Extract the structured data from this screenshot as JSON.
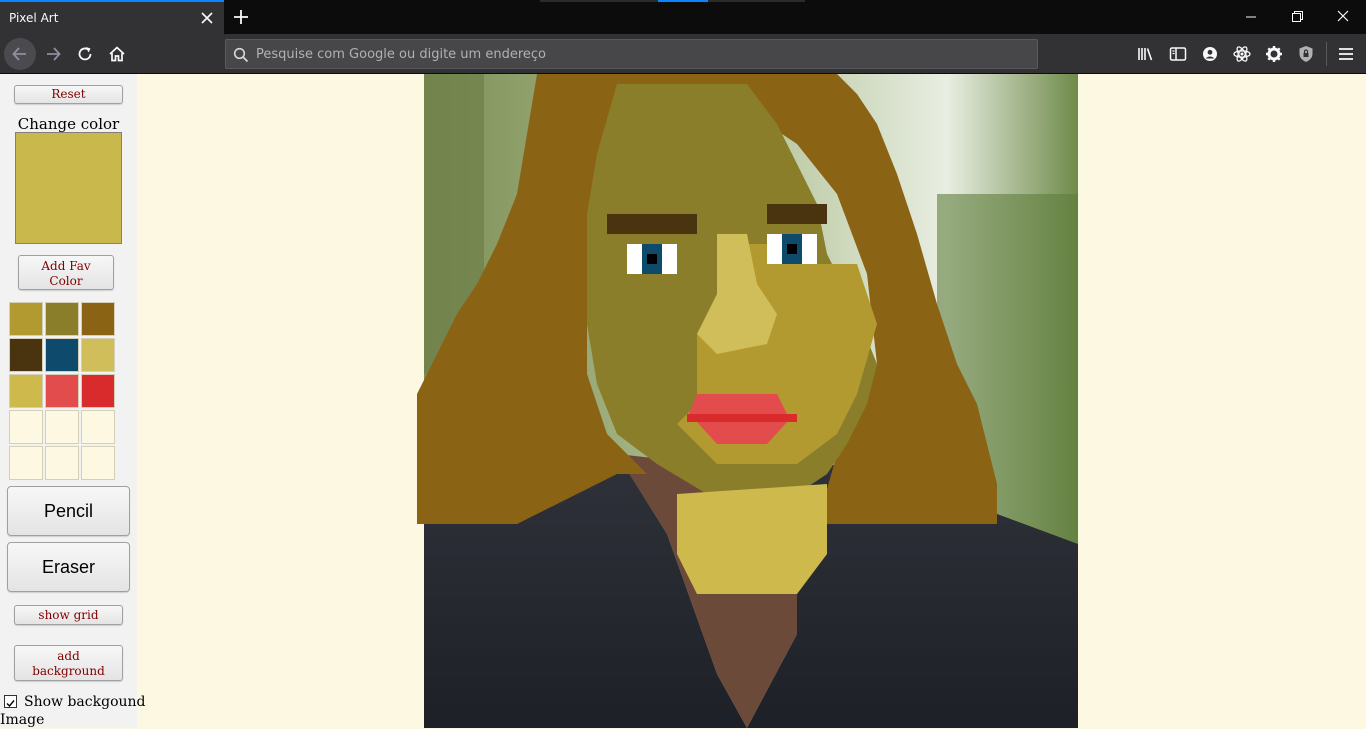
{
  "browser": {
    "tab_title": "Pixel Art",
    "url_placeholder": "Pesquise com Google ou digite um endereço"
  },
  "icons": [
    "back-arrow-icon",
    "forward-arrow-icon",
    "reload-icon",
    "home-icon",
    "search-icon",
    "library-icon",
    "sidebar-icon",
    "account-icon",
    "react-devtools-icon",
    "gear-icon",
    "shield-icon",
    "hamburger-menu-icon",
    "close-icon",
    "plus-icon",
    "minimize-icon",
    "restore-icon"
  ],
  "app": {
    "reset_label": "Reset",
    "change_color_label": "Change color",
    "current_color": "#c9b84b",
    "add_fav_label_1": "Add Fav",
    "add_fav_label_2": "Color",
    "palette": [
      "#b29a31",
      "#8b7e2a",
      "#8b6314",
      "#4a3410",
      "#0e4a6b",
      "#cfbe5a",
      "#cdb94c",
      "#e34c4c",
      "#d92b2b",
      "#fdf8e1",
      "#fdf8e1",
      "#fdf8e1",
      "#fdf8e1",
      "#fdf8e1",
      "#fdf8e1"
    ],
    "pencil_label": "Pencil",
    "eraser_label": "Eraser",
    "show_grid_label": "show grid",
    "add_bg_label_1": "add",
    "add_bg_label_2": "background",
    "show_bg_label_1": "Show backgound",
    "show_bg_label_2": "Image",
    "show_bg_checked": true
  },
  "colors": {
    "hair": "#8b6314",
    "face": "#8b7e2a",
    "skin_light": "#cfbe5a",
    "brow": "#4a3410",
    "iris": "#0e4a6b",
    "lip": "#e34c4c",
    "lip_dark": "#d92b2b",
    "bg_foliage": "#6f8a4a",
    "jacket": "#2a2d35"
  }
}
